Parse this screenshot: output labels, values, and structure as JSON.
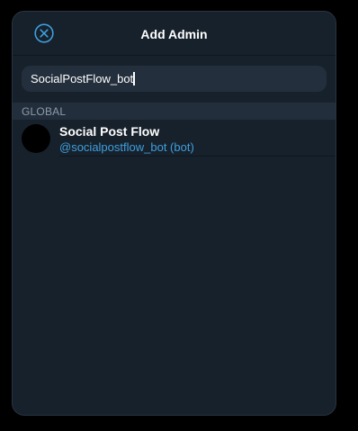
{
  "dialog": {
    "title": "Add Admin",
    "close_icon": "close-circle-icon"
  },
  "search": {
    "value": "SocialPostFlow_bot"
  },
  "results": {
    "section_label": "GLOBAL",
    "items": [
      {
        "name": "Social Post Flow",
        "subtitle": "@socialpostflow_bot (bot)"
      }
    ]
  },
  "colors": {
    "background": "#17212b",
    "accent": "#3e9fdf",
    "input_bg": "#242f3d",
    "section_bg": "#232e3c",
    "section_text": "#8d9ba8"
  }
}
